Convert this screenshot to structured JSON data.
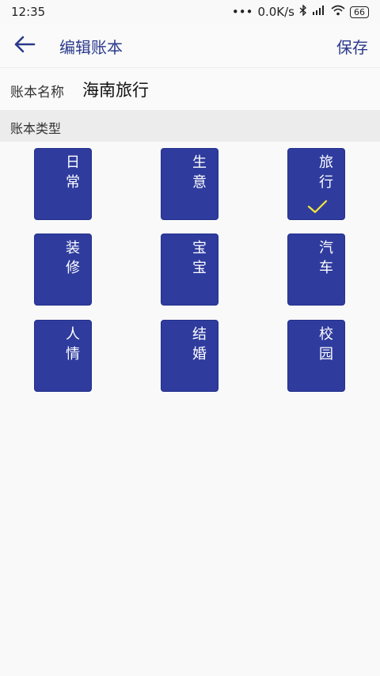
{
  "status_bar": {
    "time": "12:35",
    "network_speed": "0.0K/s",
    "battery": "66",
    "icons": [
      "bluetooth-icon",
      "hd-signal-icon",
      "wifi-icon",
      "battery-icon"
    ]
  },
  "app_bar": {
    "back_icon": "arrow-left-icon",
    "title": "编辑账本",
    "save_label": "保存"
  },
  "name_field": {
    "label": "账本名称",
    "value": "海南旅行"
  },
  "type_section": {
    "header": "账本类型",
    "selected": "旅行",
    "types": [
      {
        "label": "日常",
        "selected": false
      },
      {
        "label": "生意",
        "selected": false
      },
      {
        "label": "旅行",
        "selected": true
      },
      {
        "label": "装修",
        "selected": false
      },
      {
        "label": "宝宝",
        "selected": false
      },
      {
        "label": "汽车",
        "selected": false
      },
      {
        "label": "人情",
        "selected": false
      },
      {
        "label": "结婚",
        "selected": false
      },
      {
        "label": "校园",
        "selected": false
      }
    ]
  },
  "colors": {
    "accent": "#2b3a8c",
    "card": "#2f3c9e",
    "check": "#f5e63a"
  }
}
